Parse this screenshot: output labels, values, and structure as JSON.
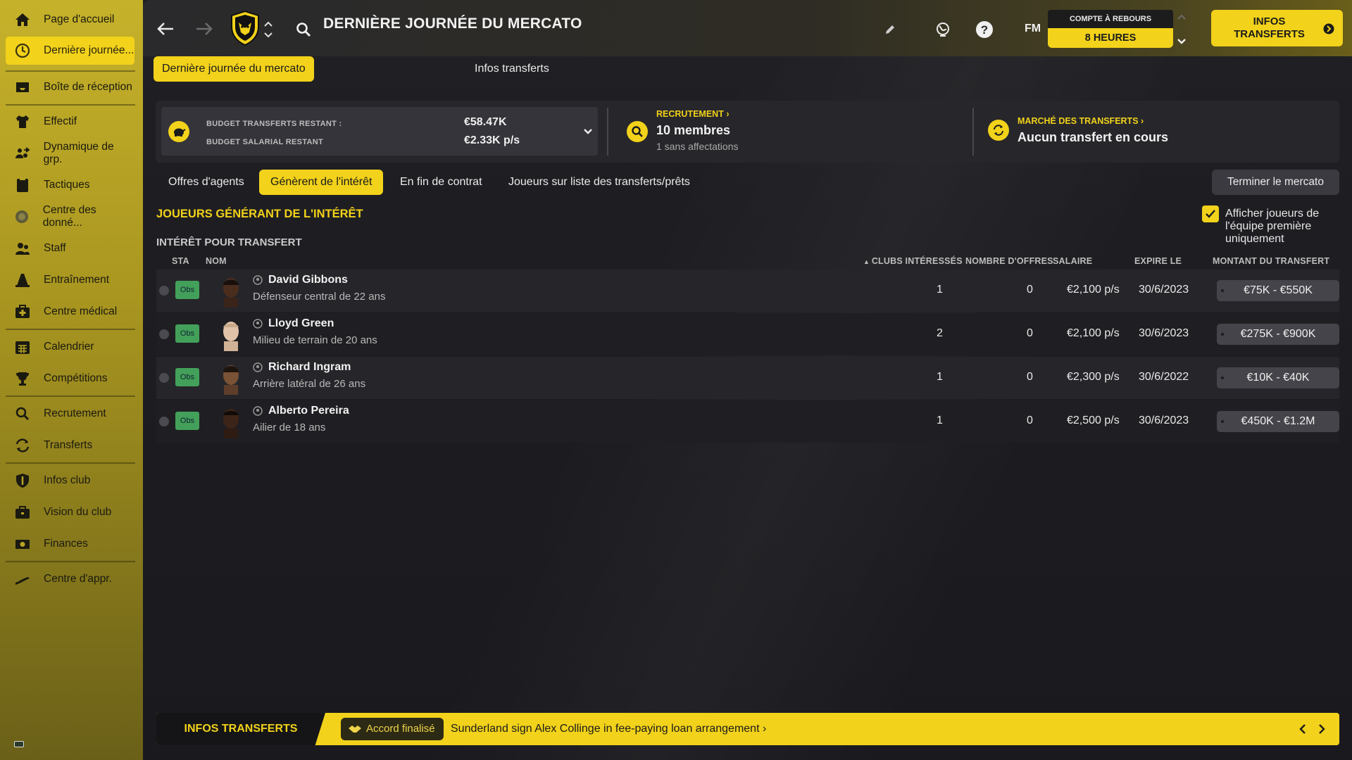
{
  "sidebar": {
    "items": [
      {
        "label": "Page d'accueil",
        "icon": "home-icon"
      },
      {
        "label": "Dernière journée...",
        "icon": "clock-icon",
        "active": true
      },
      {
        "label": "Boîte de réception",
        "icon": "inbox-icon"
      },
      {
        "label": "Effectif",
        "icon": "shirt-icon"
      },
      {
        "label": "Dynamique de grp.",
        "icon": "group-dynamics-icon"
      },
      {
        "label": "Tactiques",
        "icon": "tactics-board-icon"
      },
      {
        "label": "Centre des donné...",
        "icon": "data-hub-icon"
      },
      {
        "label": "Staff",
        "icon": "staff-icon"
      },
      {
        "label": "Entraînement",
        "icon": "training-cone-icon"
      },
      {
        "label": "Centre médical",
        "icon": "medical-kit-icon"
      },
      {
        "label": "Calendrier",
        "icon": "calendar-icon"
      },
      {
        "label": "Compétitions",
        "icon": "trophy-icon"
      },
      {
        "label": "Recrutement",
        "icon": "search-icon"
      },
      {
        "label": "Transferts",
        "icon": "transfer-arrows-icon"
      },
      {
        "label": "Infos club",
        "icon": "shield-icon"
      },
      {
        "label": "Vision du club",
        "icon": "club-vision-icon"
      },
      {
        "label": "Finances",
        "icon": "money-icon"
      },
      {
        "label": "Centre d'appr.",
        "icon": "development-icon"
      }
    ]
  },
  "header": {
    "title": "DERNIÈRE JOURNÉE DU MERCATO",
    "fm_label": "FM",
    "countdown_label": "COMPTE À REBOURS",
    "countdown_value": "8 HEURES",
    "infos_button_line1": "INFOS",
    "infos_button_line2": "TRANSFERTS"
  },
  "tabs": [
    {
      "label": "Dernière journée du mercato",
      "active": true
    },
    {
      "label": "Infos transferts",
      "active": false
    }
  ],
  "summary": {
    "budget_transfer_label": "BUDGET TRANSFERTS RESTANT :",
    "budget_transfer_value": "€58.47K",
    "budget_wage_label": "BUDGET SALARIAL RESTANT",
    "budget_wage_value": "€2.33K p/s",
    "recruitment_head": "RECRUTEMENT",
    "recruitment_big": "10 membres",
    "recruitment_small": "1 sans affectations",
    "market_head": "MARCHÉ DES TRANSFERTS",
    "market_big": "Aucun transfert en cours"
  },
  "subtabs": [
    {
      "label": "Offres d'agents",
      "active": false
    },
    {
      "label": "Génèrent de l'intérêt",
      "active": true
    },
    {
      "label": "En fin de contrat",
      "active": false
    },
    {
      "label": "Joueurs sur liste des transferts/prêts",
      "active": false
    }
  ],
  "end_button": "Terminer le mercato",
  "section_title": "JOUEURS GÉNÉRANT DE L'INTÉRÊT",
  "first_team_only_label": "Afficher joueurs de l'équipe première uniquement",
  "table": {
    "title": "INTÉRÊT POUR TRANSFERT",
    "headers": {
      "sta": "STA",
      "nom": "NOM",
      "clubs": "CLUBS INTÉRESSÉS",
      "offres": "NOMBRE D'OFFRES",
      "salaire": "SALAIRE",
      "expire": "EXPIRE LE",
      "montant": "MONTANT DU TRANSFERT"
    },
    "rows": [
      {
        "status": "Obs",
        "name": "David Gibbons",
        "desc": "Défenseur central de 22 ans",
        "clubs": "1",
        "offers": "0",
        "wage": "€2,100 p/s",
        "expires": "30/6/2023",
        "fee": "€75K - €550K"
      },
      {
        "status": "Obs",
        "name": "Lloyd Green",
        "desc": "Milieu de terrain de 20 ans",
        "clubs": "2",
        "offers": "0",
        "wage": "€2,100 p/s",
        "expires": "30/6/2023",
        "fee": "€275K - €900K"
      },
      {
        "status": "Obs",
        "name": "Richard Ingram",
        "desc": "Arrière latéral de 26 ans",
        "clubs": "1",
        "offers": "0",
        "wage": "€2,300 p/s",
        "expires": "30/6/2022",
        "fee": "€10K - €40K"
      },
      {
        "status": "Obs",
        "name": "Alberto Pereira",
        "desc": "Ailier de 18 ans",
        "clubs": "1",
        "offers": "0",
        "wage": "€2,500 p/s",
        "expires": "30/6/2023",
        "fee": "€450K - €1.2M"
      }
    ]
  },
  "ticker": {
    "title": "INFOS TRANSFERTS",
    "badge": "Accord finalisé",
    "text": "Sunderland sign Alex Collinge in fee-paying loan arrangement"
  },
  "colors": {
    "accent": "#f2d21a",
    "background": "#1b1b1f",
    "status_green": "#43a05a"
  }
}
